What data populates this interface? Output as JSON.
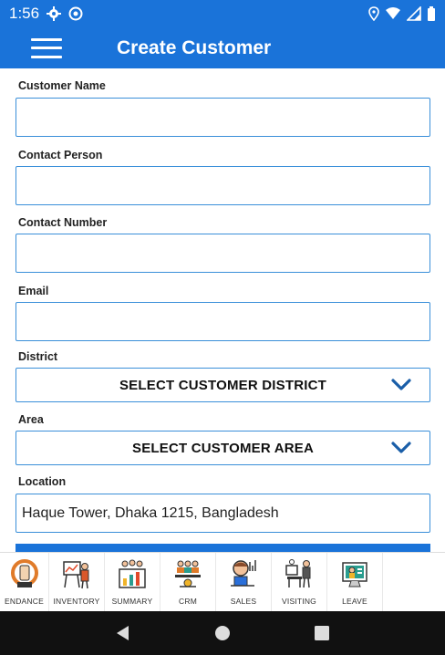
{
  "status_bar": {
    "time": "1:56"
  },
  "app_bar": {
    "title": "Create Customer"
  },
  "form": {
    "customer_name": {
      "label": "Customer Name",
      "value": ""
    },
    "contact_person": {
      "label": "Contact Person",
      "value": ""
    },
    "contact_number": {
      "label": "Contact Number",
      "value": ""
    },
    "email": {
      "label": "Email",
      "value": ""
    },
    "district": {
      "label": "District",
      "selected": "SELECT CUSTOMER DISTRICT"
    },
    "area": {
      "label": "Area",
      "selected": "SELECT CUSTOMER AREA"
    },
    "location": {
      "label": "Location",
      "value": "Haque Tower, Dhaka 1215, Bangladesh"
    }
  },
  "bottom_nav": {
    "items": [
      {
        "label": "ENDANCE",
        "icon": "attendance-icon"
      },
      {
        "label": "INVENTORY",
        "icon": "inventory-icon"
      },
      {
        "label": "SUMMARY",
        "icon": "summary-icon"
      },
      {
        "label": "CRM",
        "icon": "crm-icon"
      },
      {
        "label": "SALES",
        "icon": "sales-icon"
      },
      {
        "label": "VISITING",
        "icon": "visiting-icon"
      },
      {
        "label": "LEAVE",
        "icon": "leave-icon"
      }
    ]
  },
  "colors": {
    "primary": "#1a73d9",
    "border": "#3a8fd9",
    "nav_dark": "#111111"
  }
}
